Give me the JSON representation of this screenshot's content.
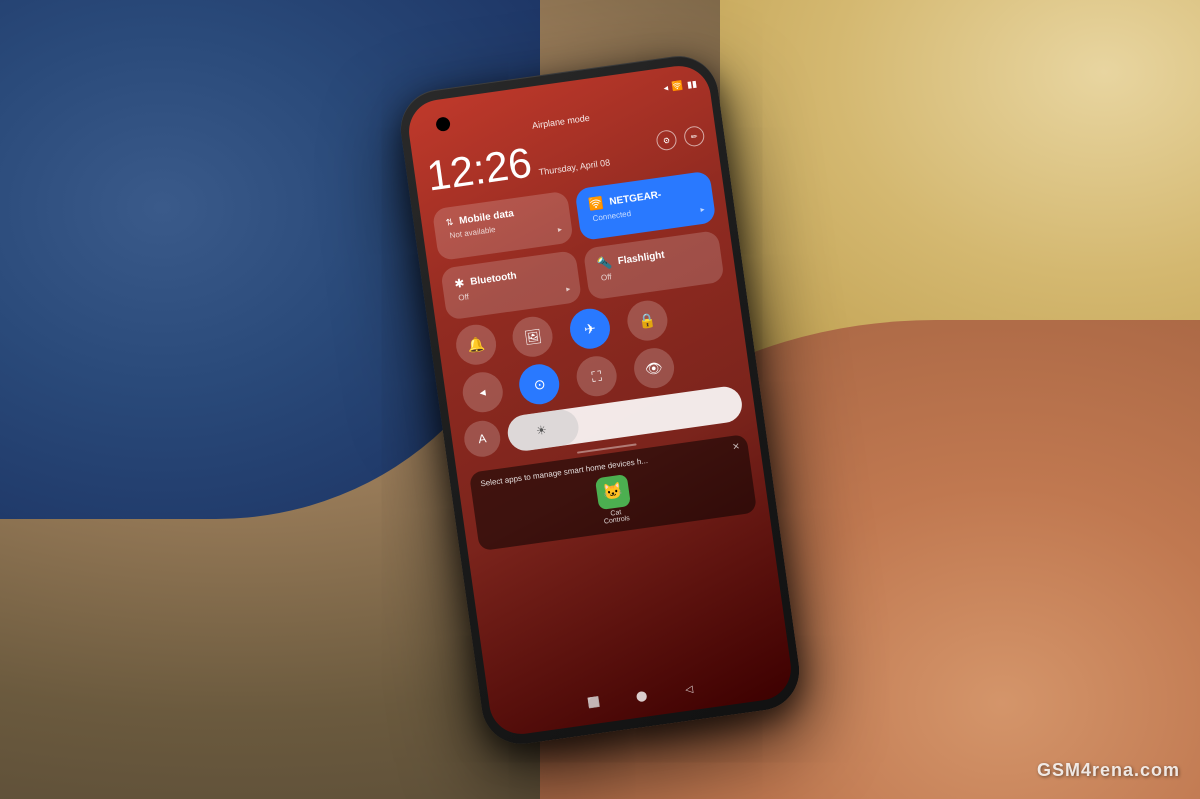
{
  "scene": {
    "watermark": "GSM4rena.com"
  },
  "phone": {
    "status_bar": {
      "airplane_icon": "✈",
      "wifi_icon": "📶",
      "battery_icon": "🔋"
    },
    "notification": "Airplane mode",
    "time": "12:26",
    "date": "Thursday, April 08",
    "icons": {
      "settings": "⚙",
      "edit": "✏"
    },
    "tiles": [
      {
        "id": "mobile-data",
        "icon": "↕",
        "title": "Mobile data",
        "subtitle": "Not available",
        "active": false
      },
      {
        "id": "wifi",
        "icon": "📶",
        "title": "NETGEAR-",
        "subtitle": "Connected",
        "active": true
      },
      {
        "id": "bluetooth",
        "icon": "✱",
        "title": "Bluetooth",
        "subtitle": "Off",
        "active": false
      },
      {
        "id": "flashlight",
        "icon": "🔦",
        "title": "Flashlight",
        "subtitle": "Off",
        "active": false
      }
    ],
    "icon_buttons": [
      {
        "id": "bell",
        "icon": "🔔",
        "active": false
      },
      {
        "id": "screenshot",
        "icon": "🖼",
        "active": false
      },
      {
        "id": "airplane",
        "icon": "✈",
        "active": true
      },
      {
        "id": "lock",
        "icon": "🔒",
        "active": false
      },
      {
        "id": "location",
        "icon": "◂",
        "active": false
      },
      {
        "id": "focus",
        "icon": "🎯",
        "active": true
      },
      {
        "id": "expand",
        "icon": "⛶",
        "active": false
      },
      {
        "id": "eye",
        "icon": "👁",
        "active": false
      }
    ],
    "brightness": {
      "icon": "☀",
      "level": 30
    },
    "smart_home": {
      "text": "Select apps to manage smart home devices h...",
      "app_name": "Cat Controls",
      "app_icon": "🐱"
    },
    "nav": {
      "square": "⬜",
      "circle": "⬤",
      "triangle": "◁"
    }
  }
}
